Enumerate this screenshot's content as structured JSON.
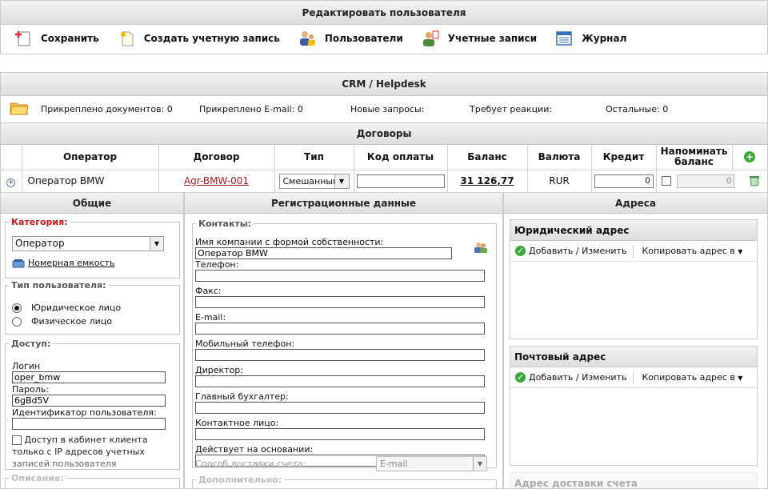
{
  "window": {
    "title": "Редактировать пользователя"
  },
  "toolbar": {
    "save": "Сохранить",
    "create_account": "Создать учетную запись",
    "users": "Пользователи",
    "accounts": "Учетные записи",
    "journal": "Журнал"
  },
  "crm": {
    "title": "CRM / Helpdesk",
    "attached_docs": "Прикреплено документов: 0",
    "attached_email": "Прикреплено E-mail: 0",
    "new_requests": "Новые запросы:",
    "needs_reaction": "Требует реакции:",
    "others": "Остальные: 0"
  },
  "contracts": {
    "title": "Договоры",
    "headers": [
      "Оператор",
      "Договор",
      "Тип",
      "Код оплаты",
      "Баланс",
      "Валюта",
      "Кредит",
      "Напоминать баланс"
    ],
    "row": {
      "operator": "Оператор BMW",
      "contract": "Agr-BMW-001",
      "type": "Смешанный",
      "payment_code": "",
      "balance": "31 126,77",
      "currency": "RUR",
      "credit": "0",
      "remind_value": "0"
    }
  },
  "general": {
    "title": "Общие",
    "category_legend": "Категория:",
    "category_value": "Оператор",
    "number_capacity": "Номерная емкость",
    "user_type_legend": "Тип пользователя:",
    "legal_entity": "Юридическое лицо",
    "individual": "Физическое лицо",
    "access_legend": "Доступ:",
    "login_label": "Логин",
    "login_value": "oper_bmw",
    "password_label": "Пароль:",
    "password_value": "6gBd5V",
    "user_id_label": "Идентификатор пользователя:",
    "user_id_value": "",
    "ip_access": "Доступ в кабинет клиента",
    "ip_access_2": "только с IP адресов учетных",
    "ip_access_3": "записей пользователя",
    "description_legend": "Описание:"
  },
  "registration": {
    "title": "Регистрационные данные",
    "contacts_legend": "Контакты:",
    "company_label": "Имя компании с формой собственности:",
    "company_value": "Оператор BMW",
    "phone": "Телефон:",
    "fax": "Факс:",
    "email": "E-mail:",
    "mobile": "Мобильный телефон:",
    "director": "Директор:",
    "accountant": "Главный бухгалтер:",
    "contact_person": "Контактное лицо:",
    "basis": "Действует на основании:",
    "delivery_label": "Способ доставки счета:",
    "delivery_value": "E-mail",
    "additional_legend": "Дополнительно:"
  },
  "addresses": {
    "title": "Адреса",
    "legal": "Юридический адрес",
    "postal": "Почтовый адрес",
    "delivery": "Адрес доставки счета",
    "add_edit": "Добавить / Изменить",
    "copy_to": "Копировать адрес в"
  }
}
